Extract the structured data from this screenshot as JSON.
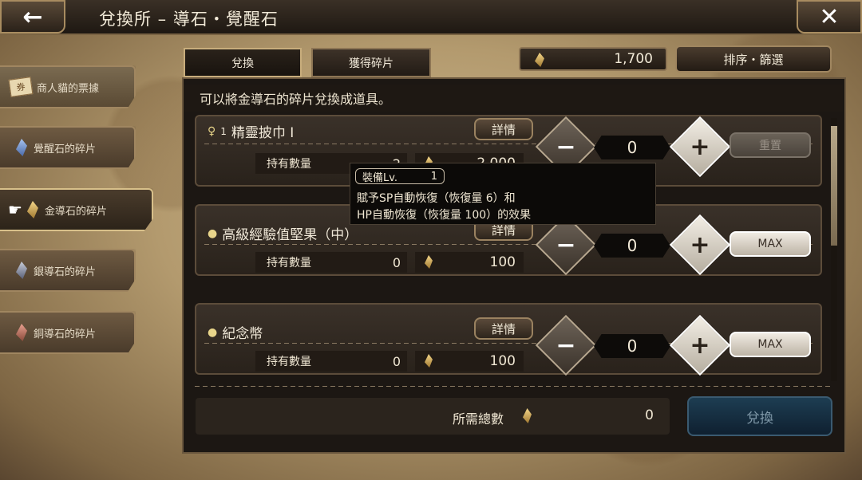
{
  "header": {
    "title": "兌換所 – 導石・覺醒石",
    "back_icon": "←",
    "close_icon": "✕"
  },
  "sidebar": {
    "items": [
      {
        "label": "商人貓的票據",
        "color": "#e8d8b0"
      },
      {
        "label": "覺醒石的碎片",
        "color": "#7a9ad8"
      },
      {
        "label": "金導石的碎片",
        "color": "#e8c870"
      },
      {
        "label": "銀導石的碎片",
        "color": "#9aa0b8"
      },
      {
        "label": "銅導石的碎片",
        "color": "#c87a6a"
      }
    ],
    "ticket_glyph": "券",
    "pointer_glyph": "☛"
  },
  "tabs": [
    {
      "label": "兌換"
    },
    {
      "label": "獲得碎片"
    }
  ],
  "currency": {
    "value": "1,700"
  },
  "sort_button": {
    "label": "排序・篩選"
  },
  "description": "可以將金導石的碎片兌換成道具。",
  "items": [
    {
      "icon": "♀",
      "level": "1",
      "name": "精靈披巾 I",
      "detail_label": "詳情",
      "owned_label": "持有數量",
      "owned": "2",
      "cost": "2,000",
      "qty": "0",
      "action_label": "重置",
      "action_disabled": true
    },
    {
      "icon": "●",
      "name": "高級經驗值堅果（中）",
      "detail_label": "詳情",
      "owned_label": "持有數量",
      "owned": "0",
      "cost": "100",
      "qty": "0",
      "action_label": "MAX"
    },
    {
      "icon": "●",
      "name": "紀念幣",
      "detail_label": "詳情",
      "owned_label": "持有數量",
      "owned": "0",
      "cost": "100",
      "qty": "0",
      "action_label": "MAX"
    }
  ],
  "tooltip": {
    "lv_label": "裝備Lv.",
    "lv_value": "1",
    "line1": "賦予SP自動恢復（恢復量 6）和",
    "line2": "HP自動恢復（恢復量 100）的效果"
  },
  "footer": {
    "total_label": "所需總數",
    "total_value": "0",
    "exchange_label": "兌換"
  },
  "buttons": {
    "minus": "−",
    "plus": "+"
  }
}
